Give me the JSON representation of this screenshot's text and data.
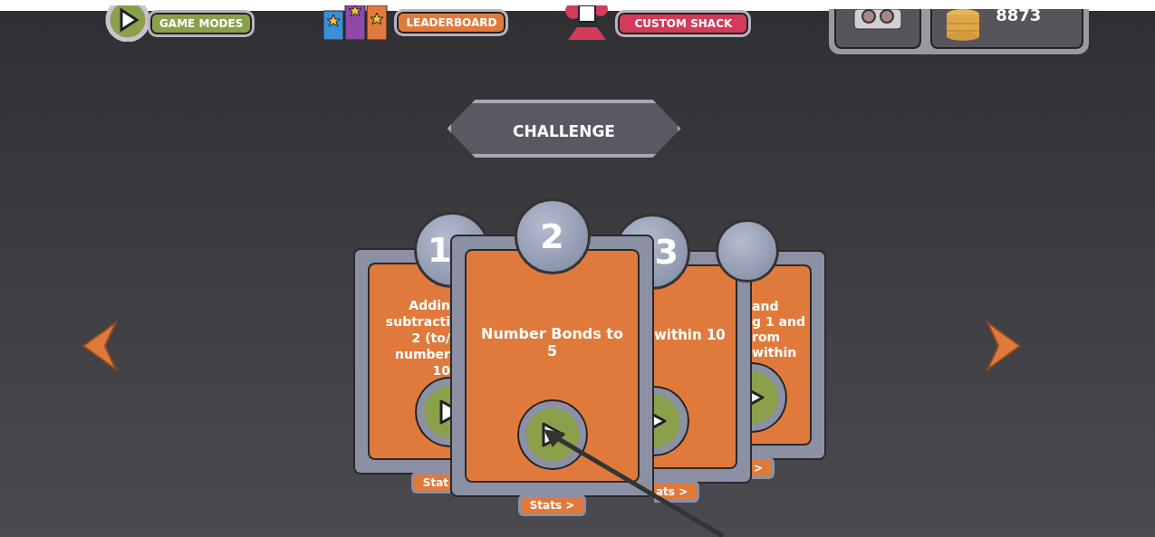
{
  "top_bar": {
    "buttons": [
      {
        "kind": "game_modes",
        "label": "GAME MODES"
      },
      {
        "kind": "leaderboard",
        "label": "LEADERBOARD"
      },
      {
        "kind": "custom_shack",
        "label": "CUSTOM SHACK"
      }
    ],
    "coins": "8873"
  },
  "title": "CHALLENGE",
  "cards": [
    {
      "kind": "left-peek",
      "number": "1",
      "lines": [
        "Addin",
        "subtracti",
        "2 (to/",
        "number",
        "10"
      ],
      "stats": "Stat"
    },
    {
      "kind": "front",
      "number": "2",
      "lines": [
        "Number Bonds to",
        "5"
      ],
      "stats": "Stats >"
    },
    {
      "kind": "right-peek",
      "number": "3",
      "lines": [
        "within 10"
      ],
      "stats": "ats >"
    },
    {
      "kind": "right-peek",
      "lines": [
        "and",
        "g 1 and",
        "rom",
        "within"
      ],
      "stats": ">"
    }
  ]
}
